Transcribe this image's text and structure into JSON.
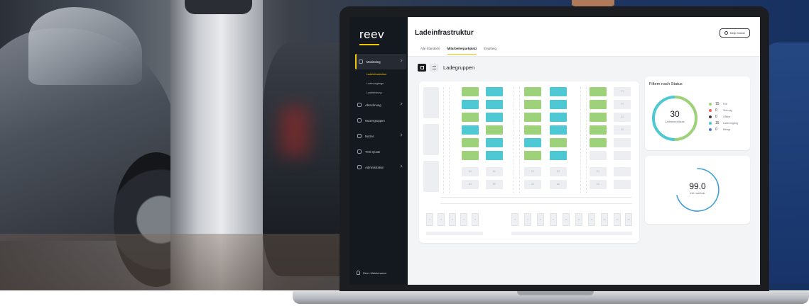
{
  "sidebar": {
    "logo": "reev",
    "items": [
      {
        "label": "Monitoring",
        "icon": "gauge-icon"
      },
      {
        "label": "Abrechnung",
        "icon": "receipt-icon"
      },
      {
        "label": "Nutzergruppen",
        "icon": "users-icon"
      },
      {
        "label": "Nutzer",
        "icon": "user-icon"
      },
      {
        "label": "THG Quote",
        "icon": "leaf-icon"
      },
      {
        "label": "Administration",
        "icon": "settings-icon"
      }
    ],
    "subitems": [
      "Ladeinfrastruktur",
      "Ladevorgänge",
      "Ladeleistung"
    ],
    "footer": "Reev Maintenance"
  },
  "header": {
    "title": "Ladeinfrastruktur",
    "help_label": "Help Center",
    "tabs": [
      "Alle Standorte",
      "Mitarbeiterparkplatz",
      "Empfang"
    ]
  },
  "section": {
    "title": "Ladegruppen"
  },
  "grid": {
    "empty_labels": [
      "A1",
      "A2",
      "B1",
      "B2",
      "C1",
      "C2",
      "D1",
      "D2",
      "E1",
      "E2",
      "F1",
      "F2",
      "G1",
      "G2"
    ],
    "bottom_labels": [
      "1",
      "2",
      "3",
      "4",
      "5",
      "6",
      "7",
      "8",
      "9",
      "10",
      "11",
      "12",
      "13",
      "14",
      "15"
    ]
  },
  "filter": {
    "title": "Filtern nach Status",
    "total": "30",
    "total_label": "Ladeanschlüsse",
    "statuses": [
      {
        "count": "15",
        "label": "Frei",
        "color": "#9ed27a"
      },
      {
        "count": "0",
        "label": "Störung",
        "color": "#e8665b"
      },
      {
        "count": "0",
        "label": "Offline",
        "color": "#3a3d44"
      },
      {
        "count": "15",
        "label": "Ladevorgang",
        "color": "#4ec8d3"
      },
      {
        "count": "0",
        "label": "Belegt",
        "color": "#4a7bd6"
      }
    ]
  },
  "power": {
    "value": "99.0",
    "label": "kW Ladelast"
  },
  "colors": {
    "accent": "#f4c500",
    "free": "#9ed27a",
    "charging": "#4ec8d3"
  }
}
